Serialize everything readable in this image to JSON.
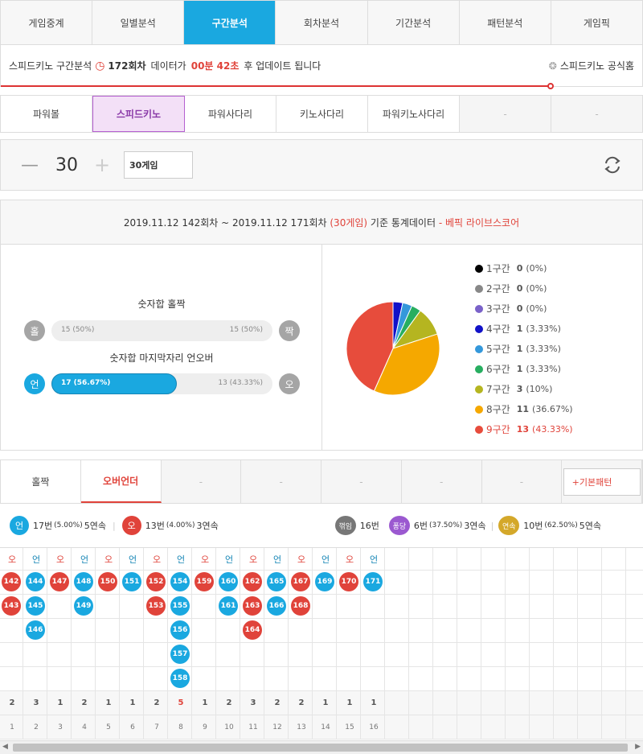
{
  "tabs": [
    "게임중계",
    "일별분석",
    "구간분석",
    "회차분석",
    "기간분석",
    "패턴분석",
    "게임픽"
  ],
  "notice": {
    "title": "스피드키노 구간분석",
    "round": "172회차",
    "mid": "데이터가",
    "time": "00분 42초",
    "tail": "후 업데이트 됩니다",
    "home": "스피드키노 공식홈"
  },
  "subtabs": [
    "파워볼",
    "스피드키노",
    "파워사다리",
    "키노사다리",
    "파워키노사다리",
    "-",
    "-"
  ],
  "control": {
    "count": "30",
    "select": "30게임",
    "minus": "—",
    "plus": "+"
  },
  "stat_header": {
    "range": "2019.11.12 142회차 ~ 2019.11.12 171회차",
    "games": "(30게임)",
    "mid": "기준 통계데이터",
    "brand": "- 베픽 라이브스코어"
  },
  "oddeven": {
    "label": "숫자합 홀짝",
    "left_badge": "홀",
    "right_badge": "짝",
    "left": "15 (50%)",
    "right": "15 (50%)",
    "fill": 0.5
  },
  "overunder": {
    "label": "숫자합 마지막자리 언오버",
    "left_badge": "언",
    "right_badge": "오",
    "left": "17 (56.67%)",
    "right": "13 (43.33%)",
    "fill": 0.5667
  },
  "legend": [
    {
      "name": "1구간",
      "val": "0",
      "pct": "(0%)",
      "color": "#000000"
    },
    {
      "name": "2구간",
      "val": "0",
      "pct": "(0%)",
      "color": "#888888"
    },
    {
      "name": "3구간",
      "val": "0",
      "pct": "(0%)",
      "color": "#7a62c9"
    },
    {
      "name": "4구간",
      "val": "1",
      "pct": "(3.33%)",
      "color": "#1212c8"
    },
    {
      "name": "5구간",
      "val": "1",
      "pct": "(3.33%)",
      "color": "#3498db"
    },
    {
      "name": "6구간",
      "val": "1",
      "pct": "(3.33%)",
      "color": "#27ae60"
    },
    {
      "name": "7구간",
      "val": "3",
      "pct": "(10%)",
      "color": "#b5b520"
    },
    {
      "name": "8구간",
      "val": "11",
      "pct": "(36.67%)",
      "color": "#f5a800"
    },
    {
      "name": "9구간",
      "val": "13",
      "pct": "(43.33%)",
      "color": "#e74c3c"
    }
  ],
  "pattern_tabs": [
    "홀짝",
    "오버언더",
    "-",
    "-",
    "-",
    "-",
    "-"
  ],
  "pattern_button": "+기본패턴",
  "summary": {
    "u_badge": "언",
    "u_text": "17번",
    "u_pct": "(5.00%)",
    "u_streak": "5연속",
    "o_badge": "오",
    "o_text": "13번",
    "o_pct": "(4.00%)",
    "o_streak": "3연속",
    "k_badge": "꺾임",
    "k_text": "16번",
    "p_badge": "퐁당",
    "p_text": "6번",
    "p_pct": "(37.50%)",
    "p_streak": "3연속",
    "y_badge": "연속",
    "y_text": "10번",
    "y_pct": "(62.50%)",
    "y_streak": "5연속"
  },
  "columns": [
    {
      "h": "오",
      "t": "o",
      "balls": [
        "142",
        "143"
      ]
    },
    {
      "h": "언",
      "t": "u",
      "balls": [
        "144",
        "145",
        "146"
      ]
    },
    {
      "h": "오",
      "t": "o",
      "balls": [
        "147"
      ]
    },
    {
      "h": "언",
      "t": "u",
      "balls": [
        "148",
        "149"
      ]
    },
    {
      "h": "오",
      "t": "o",
      "balls": [
        "150"
      ]
    },
    {
      "h": "언",
      "t": "u",
      "balls": [
        "151"
      ]
    },
    {
      "h": "오",
      "t": "o",
      "balls": [
        "152",
        "153"
      ]
    },
    {
      "h": "언",
      "t": "u",
      "balls": [
        "154",
        "155",
        "156",
        "157",
        "158"
      ]
    },
    {
      "h": "오",
      "t": "o",
      "balls": [
        "159"
      ]
    },
    {
      "h": "언",
      "t": "u",
      "balls": [
        "160",
        "161"
      ]
    },
    {
      "h": "오",
      "t": "o",
      "balls": [
        "162",
        "163",
        "164"
      ]
    },
    {
      "h": "언",
      "t": "u",
      "balls": [
        "165",
        "166"
      ]
    },
    {
      "h": "오",
      "t": "o",
      "balls": [
        "167",
        "168"
      ]
    },
    {
      "h": "언",
      "t": "u",
      "balls": [
        "169"
      ]
    },
    {
      "h": "오",
      "t": "o",
      "balls": [
        "170"
      ]
    },
    {
      "h": "언",
      "t": "u",
      "balls": [
        "171"
      ]
    }
  ],
  "counts": [
    "2",
    "3",
    "1",
    "2",
    "1",
    "1",
    "2",
    "5",
    "1",
    "2",
    "3",
    "2",
    "2",
    "1",
    "1",
    "1"
  ],
  "indexes": [
    "1",
    "2",
    "3",
    "4",
    "5",
    "6",
    "7",
    "8",
    "9",
    "10",
    "11",
    "12",
    "13",
    "14",
    "15",
    "16"
  ]
}
